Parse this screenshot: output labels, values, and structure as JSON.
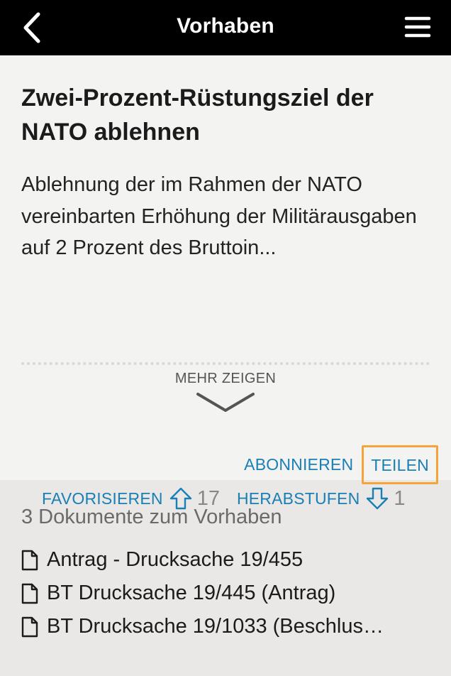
{
  "navbar": {
    "title": "Vorhaben",
    "back_icon": "chevron-left-icon",
    "menu_icon": "hamburger-menu-icon"
  },
  "proposal": {
    "title": "Zwei-Prozent-Rüstungsziel der NATO ablehnen",
    "description": "Ablehnung der im Rahmen der NATO vereinbarten Erhöhung der Militärausgaben auf 2 Prozent des Bruttoin...",
    "more_label": "MEHR ZEIGEN"
  },
  "actions": {
    "subscribe_label": "ABONNIEREN",
    "share_label": "TEILEN",
    "favorite_label": "FAVORISIEREN",
    "upvote_count": "17",
    "downgrade_label": "HERABSTUFEN",
    "downvote_count": "1",
    "link_color": "#1a7fb5",
    "highlight_color": "#f5a33a"
  },
  "documents": {
    "heading": "3 Dokumente zum Vorhaben",
    "items": [
      {
        "label": "Antrag - Drucksache 19/455"
      },
      {
        "label": "BT Drucksache 19/445 (Antrag)"
      },
      {
        "label": "BT Drucksache 19/1033 (Beschlus…"
      }
    ]
  }
}
